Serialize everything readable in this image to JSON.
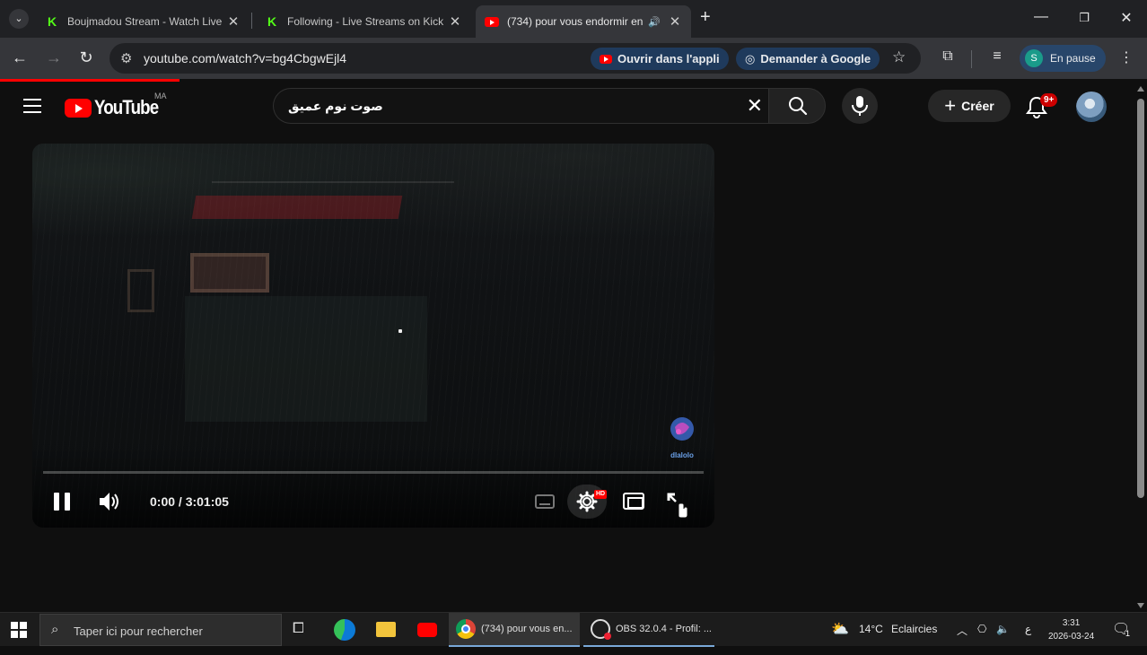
{
  "browser": {
    "tabs": [
      {
        "title": "Boujmadou Stream - Watch Live",
        "favicon": "kick-icon"
      },
      {
        "title": "Following - Live Streams on Kick",
        "favicon": "kick-icon"
      },
      {
        "title": "(734) pour vous endormir en",
        "favicon": "youtube-icon",
        "active": true
      }
    ],
    "new_tab": "+",
    "url": "youtube.com/watch?v=bg4CbgwEjl4",
    "chip_open_app": "Ouvrir dans l'appli",
    "chip_ask_google": "Demander à Google",
    "profile_initial": "S",
    "profile_status": "En pause",
    "accent": "#ff0000"
  },
  "youtube": {
    "logo_text": "YouTube",
    "country_code": "MA",
    "search_query": "صوت نوم عميق",
    "create_label": "Créer",
    "notif_badge": "9+",
    "player": {
      "time": "0:00 / 3:01:05",
      "progress": 0,
      "hd_badge": "HD",
      "watermark": "dlalolo"
    }
  },
  "taskbar": {
    "search_placeholder": "Taper ici pour rechercher",
    "chrome_item": "(734) pour vous en...",
    "obs_item": "OBS 32.0.4 - Profil: ...",
    "weather_temp": "14°C",
    "weather_text": "Eclaircies",
    "lang": "ع",
    "time": "3:31",
    "date": "2026-03-24",
    "notif_count": "1"
  }
}
